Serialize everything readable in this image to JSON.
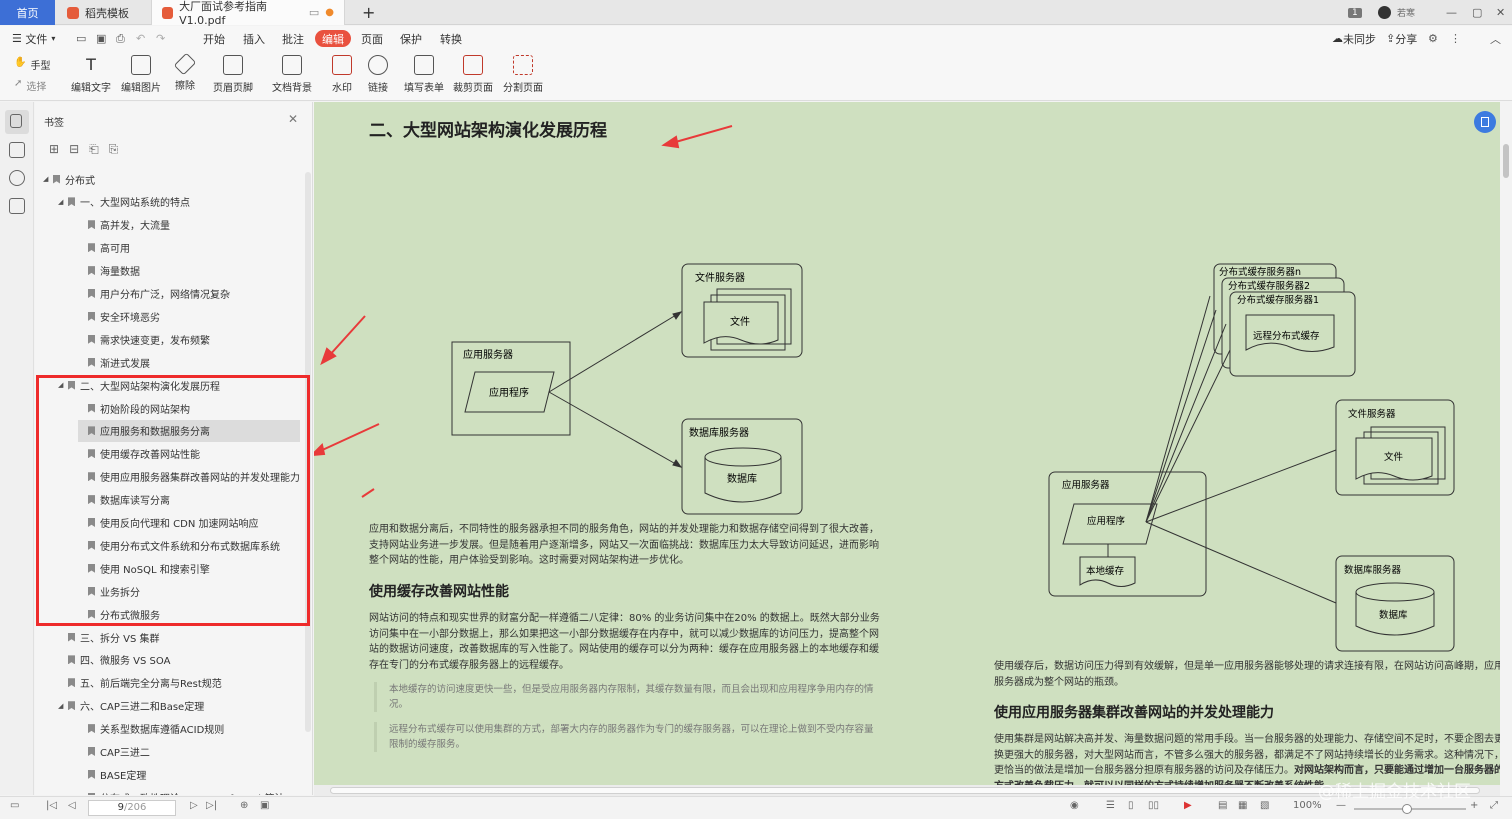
{
  "tabs": {
    "home": "首页",
    "template": "稻壳模板",
    "doc": "大厂面试参考指南V1.0.pdf",
    "badge": "1",
    "user": "若寒"
  },
  "menu": {
    "file": "文件",
    "start": "开始",
    "insert": "插入",
    "annotate": "批注",
    "edit": "编辑",
    "page": "页面",
    "protect": "保护",
    "convert": "转换",
    "sync": "未同步",
    "share": "分享"
  },
  "tools": {
    "hand": "手型",
    "select": "选择",
    "edit_text": "编辑文字",
    "edit_image": "编辑图片",
    "erase": "擦除",
    "header_footer": "页眉页脚",
    "background": "文档背景",
    "watermark": "水印",
    "link": "链接",
    "fill_form": "填写表单",
    "crop": "裁剪页面",
    "split": "分割页面"
  },
  "panel": {
    "title": "书签"
  },
  "bookmarks": [
    {
      "label": "分布式",
      "level": 0,
      "expanded": true
    },
    {
      "label": "一、大型网站系统的特点",
      "level": 1,
      "expanded": true
    },
    {
      "label": "高并发，大流量",
      "level": 2
    },
    {
      "label": "高可用",
      "level": 2
    },
    {
      "label": "海量数据",
      "level": 2
    },
    {
      "label": "用户分布广泛，网络情况复杂",
      "level": 2
    },
    {
      "label": "安全环境恶劣",
      "level": 2
    },
    {
      "label": "需求快速变更，发布频繁",
      "level": 2
    },
    {
      "label": "渐进式发展",
      "level": 2
    },
    {
      "label": "二、大型网站架构演化发展历程",
      "level": 1,
      "expanded": true
    },
    {
      "label": "初始阶段的网站架构",
      "level": 2
    },
    {
      "label": "应用服务和数据服务分离",
      "level": 2,
      "selected": true
    },
    {
      "label": "使用缓存改善网站性能",
      "level": 2
    },
    {
      "label": "使用应用服务器集群改善网站的并发处理能力",
      "level": 2
    },
    {
      "label": "数据库读写分离",
      "level": 2
    },
    {
      "label": "使用反向代理和 CDN 加速网站响应",
      "level": 2
    },
    {
      "label": "使用分布式文件系统和分布式数据库系统",
      "level": 2
    },
    {
      "label": "使用 NoSQL 和搜索引擎",
      "level": 2
    },
    {
      "label": "业务拆分",
      "level": 2
    },
    {
      "label": "分布式微服务",
      "level": 2
    },
    {
      "label": "三、拆分 VS 集群",
      "level": 1
    },
    {
      "label": "四、微服务 VS SOA",
      "level": 1
    },
    {
      "label": "五、前后端完全分离与Rest规范",
      "level": 1
    },
    {
      "label": "六、CAP三进二和Base定理",
      "level": 1,
      "expanded": true
    },
    {
      "label": "关系型数据库遵循ACID规则",
      "level": 2
    },
    {
      "label": "CAP三进二",
      "level": 2
    },
    {
      "label": "BASE定理",
      "level": 2
    },
    {
      "label": "分布式一致性理论paxos、raft、zab算法",
      "level": 2
    }
  ],
  "doc": {
    "heading1": "二、大型网站架构演化发展历程",
    "para1": "应用和数据分离后，不同特性的服务器承担不同的服务角色，网站的并发处理能力和数据存储空间得到了很大改善，支持网站业务进一步发展。但是随着用户逐渐增多，网站又一次面临挑战：数据库压力太大导致访问延迟，进而影响整个网站的性能，用户体验受到影响。这时需要对网站架构进一步优化。",
    "heading2": "使用缓存改善网站性能",
    "para2": "网站访问的特点和现实世界的财富分配一样遵循二八定律：80% 的业务访问集中在20% 的数据上。既然大部分业务访问集中在一小部分数据上，那么如果把这一小部分数据缓存在内存中，就可以减少数据库的访问压力，提高整个网站的数据访问速度，改善数据库的写入性能了。网站使用的缓存可以分为两种：缓存在应用服务器上的本地缓存和缓存在专门的分布式缓存服务器上的远程缓存。",
    "quote1": "本地缓存的访问速度更快一些，但是受应用服务器内存限制，其缓存数量有限，而且会出现和应用程序争用内存的情况。",
    "quote2": "远程分布式缓存可以使用集群的方式，部署大内存的服务器作为专门的缓存服务器，可以在理论上做到不受内存容量限制的缓存服务。",
    "para3": "使用缓存后，数据访问压力得到有效缓解，但是单一应用服务器能够处理的请求连接有限，在网站访问高峰期，应用服务器成为整个网站的瓶颈。",
    "heading3": "使用应用服务器集群改善网站的并发处理能力",
    "para4": "使用集群是网站解决高并发、海量数据问题的常用手段。当一台服务器的处理能力、存储空间不足时，不要企图去更换更强大的服务器，对大型网站而言，不管多么强大的服务器，都满足不了网站持续增长的业务需求。这种情况下，更恰当的做法是增加一台服务器分担原有服务器的访问及存储压力。",
    "para4_bold": "对网站架构而言，只要能通过增加一台服务器的方式改善负载压力，就可以以同样的方式持续增加服务器不断改善系统性能"
  },
  "diagram1": {
    "app_server": "应用服务器",
    "app": "应用程序",
    "file_server": "文件服务器",
    "file": "文件",
    "db_server": "数据库服务器",
    "db": "数据库"
  },
  "diagram2": {
    "cache_n": "分布式缓存服务器n",
    "cache_2": "分布式缓存服务器2",
    "cache_1": "分布式缓存服务器1",
    "remote_cache": "远程分布式缓存",
    "app_server": "应用服务器",
    "app": "应用程序",
    "local_cache": "本地缓存",
    "file_server": "文件服务器",
    "file": "文件",
    "db_server": "数据库服务器",
    "db": "数据库"
  },
  "status": {
    "page": "9",
    "total": "/206",
    "zoom": "100%",
    "watermark": "@稀土掘金技术社区"
  }
}
